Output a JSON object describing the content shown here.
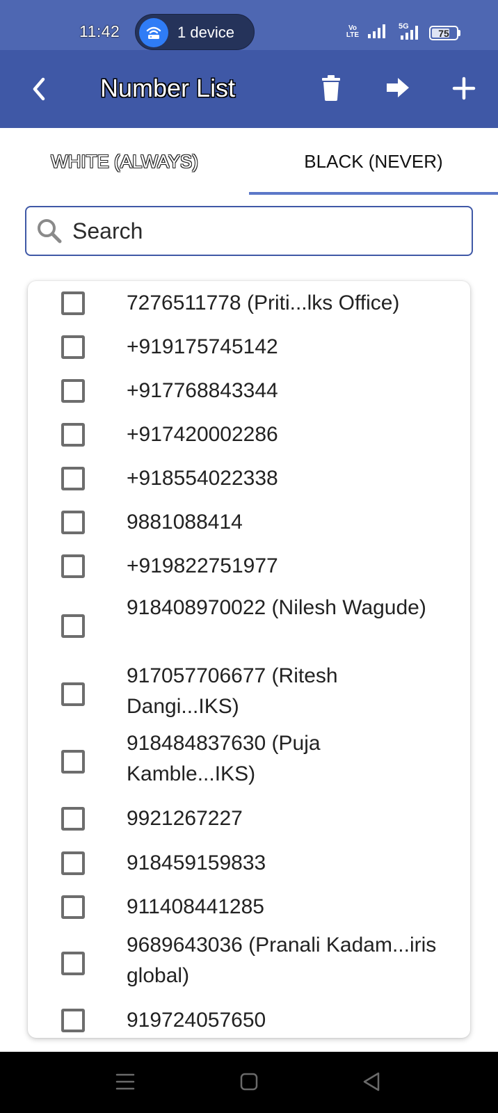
{
  "status_bar": {
    "time": "11:42",
    "hotspot_label": "1 device",
    "volte_text": "Vo\nLTE",
    "network_label": "5G",
    "battery_level": "75",
    "battery_fraction": 0.75
  },
  "app_bar": {
    "title": "Number List",
    "background_color": "#3f58a6"
  },
  "tabs": [
    {
      "label": "WHITE (ALWAYS)",
      "selected": false
    },
    {
      "label": "BLACK (NEVER)",
      "selected": true
    }
  ],
  "search": {
    "placeholder": "Search",
    "value": ""
  },
  "numbers": [
    {
      "label": "7276511778 (Priti...lks Office)",
      "checked": false
    },
    {
      "label": "+919175745142",
      "checked": false
    },
    {
      "label": "+917768843344",
      "checked": false
    },
    {
      "label": "+917420002286",
      "checked": false
    },
    {
      "label": "+918554022338",
      "checked": false
    },
    {
      "label": "9881088414",
      "checked": false
    },
    {
      "label": "+919822751977",
      "checked": false
    },
    {
      "label": "918408970022 (Nilesh Wagude)",
      "checked": false
    },
    {
      "label": "917057706677 (Ritesh Dangi...IKS)",
      "checked": false
    },
    {
      "label": "918484837630 (Puja Kamble...IKS)",
      "checked": false
    },
    {
      "label": "9921267227",
      "checked": false
    },
    {
      "label": "918459159833",
      "checked": false
    },
    {
      "label": "911408441285",
      "checked": false
    },
    {
      "label": "9689643036 (Pranali Kadam...iris global)",
      "checked": false
    },
    {
      "label": "919724057650",
      "checked": false
    }
  ],
  "icons": {
    "back": "back-arrow-icon",
    "delete": "trash-icon",
    "export": "arrow-right-icon",
    "add": "plus-icon",
    "search": "search-icon"
  }
}
